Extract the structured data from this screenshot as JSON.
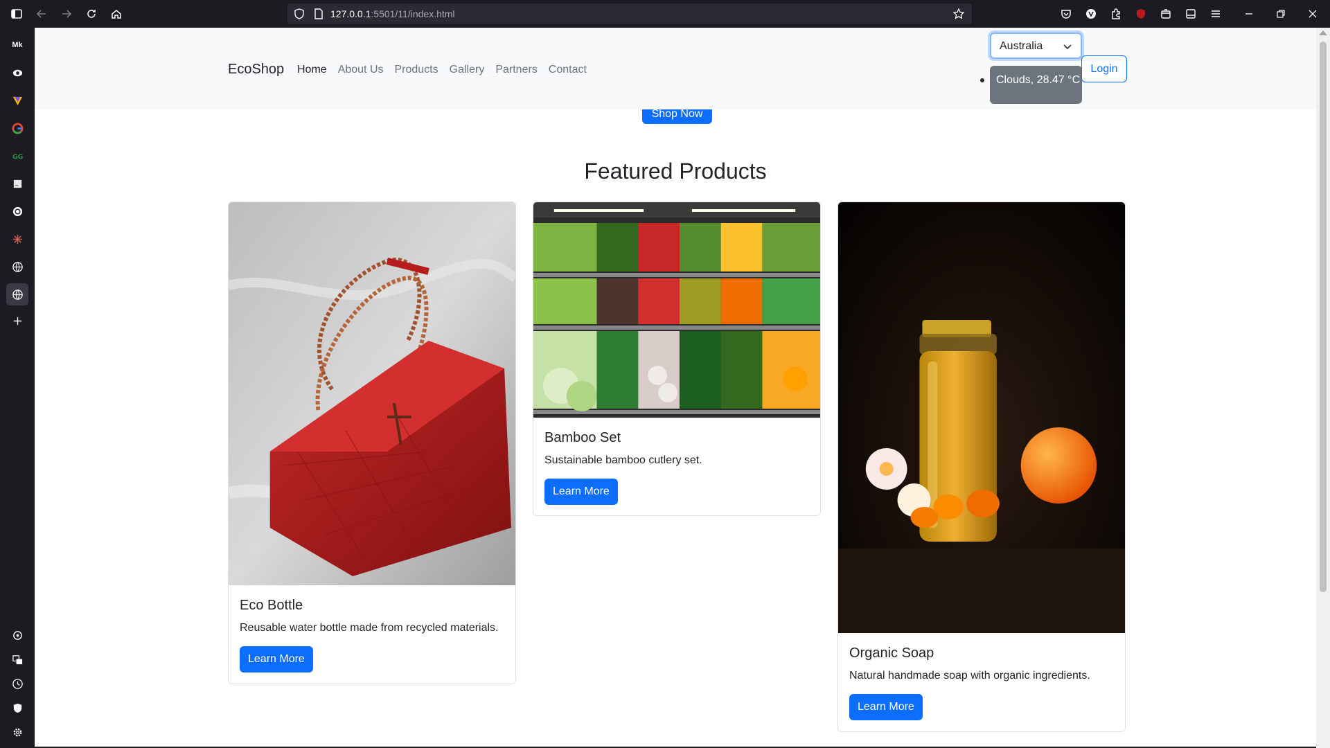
{
  "browser": {
    "url_host": "127.0.0.1",
    "url_path": ":5501/11/index.html"
  },
  "sidebar": {
    "icons": [
      "sidebar-toggle-icon",
      "mk-icon",
      "eye-icon",
      "vivaldi-icon",
      "google-icon",
      "gfg-icon",
      "note-icon",
      "openai-icon",
      "spark-icon",
      "globe-icon",
      "globe-active-icon",
      "plus-icon",
      "ai-icon",
      "translate-icon",
      "history-icon",
      "shield-icon",
      "settings-icon"
    ],
    "mk_label": "Mk"
  },
  "navbar": {
    "brand": "EcoShop",
    "links": [
      "Home",
      "About Us",
      "Products",
      "Gallery",
      "Partners",
      "Contact"
    ],
    "country_selected": "Australia",
    "weather": "Clouds, 28.47 °C",
    "login": "Login"
  },
  "hero": {
    "shop_now": "Shop Now"
  },
  "featured": {
    "title": "Featured Products",
    "products": [
      {
        "name": "Eco Bottle",
        "description": "Reusable water bottle made from recycled materials.",
        "button": "Learn More",
        "image": "red quilted handbag on white sheet"
      },
      {
        "name": "Bamboo Set",
        "description": "Sustainable bamboo cutlery set.",
        "button": "Learn More",
        "image": "supermarket vegetable shelves"
      },
      {
        "name": "Organic Soap",
        "description": "Natural handmade soap with organic ingredients.",
        "button": "Learn More",
        "image": "honey jar with orange and flowers"
      }
    ]
  },
  "colors": {
    "primary": "#0d6efd",
    "navbar_bg": "#f8f9fa",
    "weather_bg": "#6c757d",
    "chrome_bg": "#1c1b22"
  }
}
